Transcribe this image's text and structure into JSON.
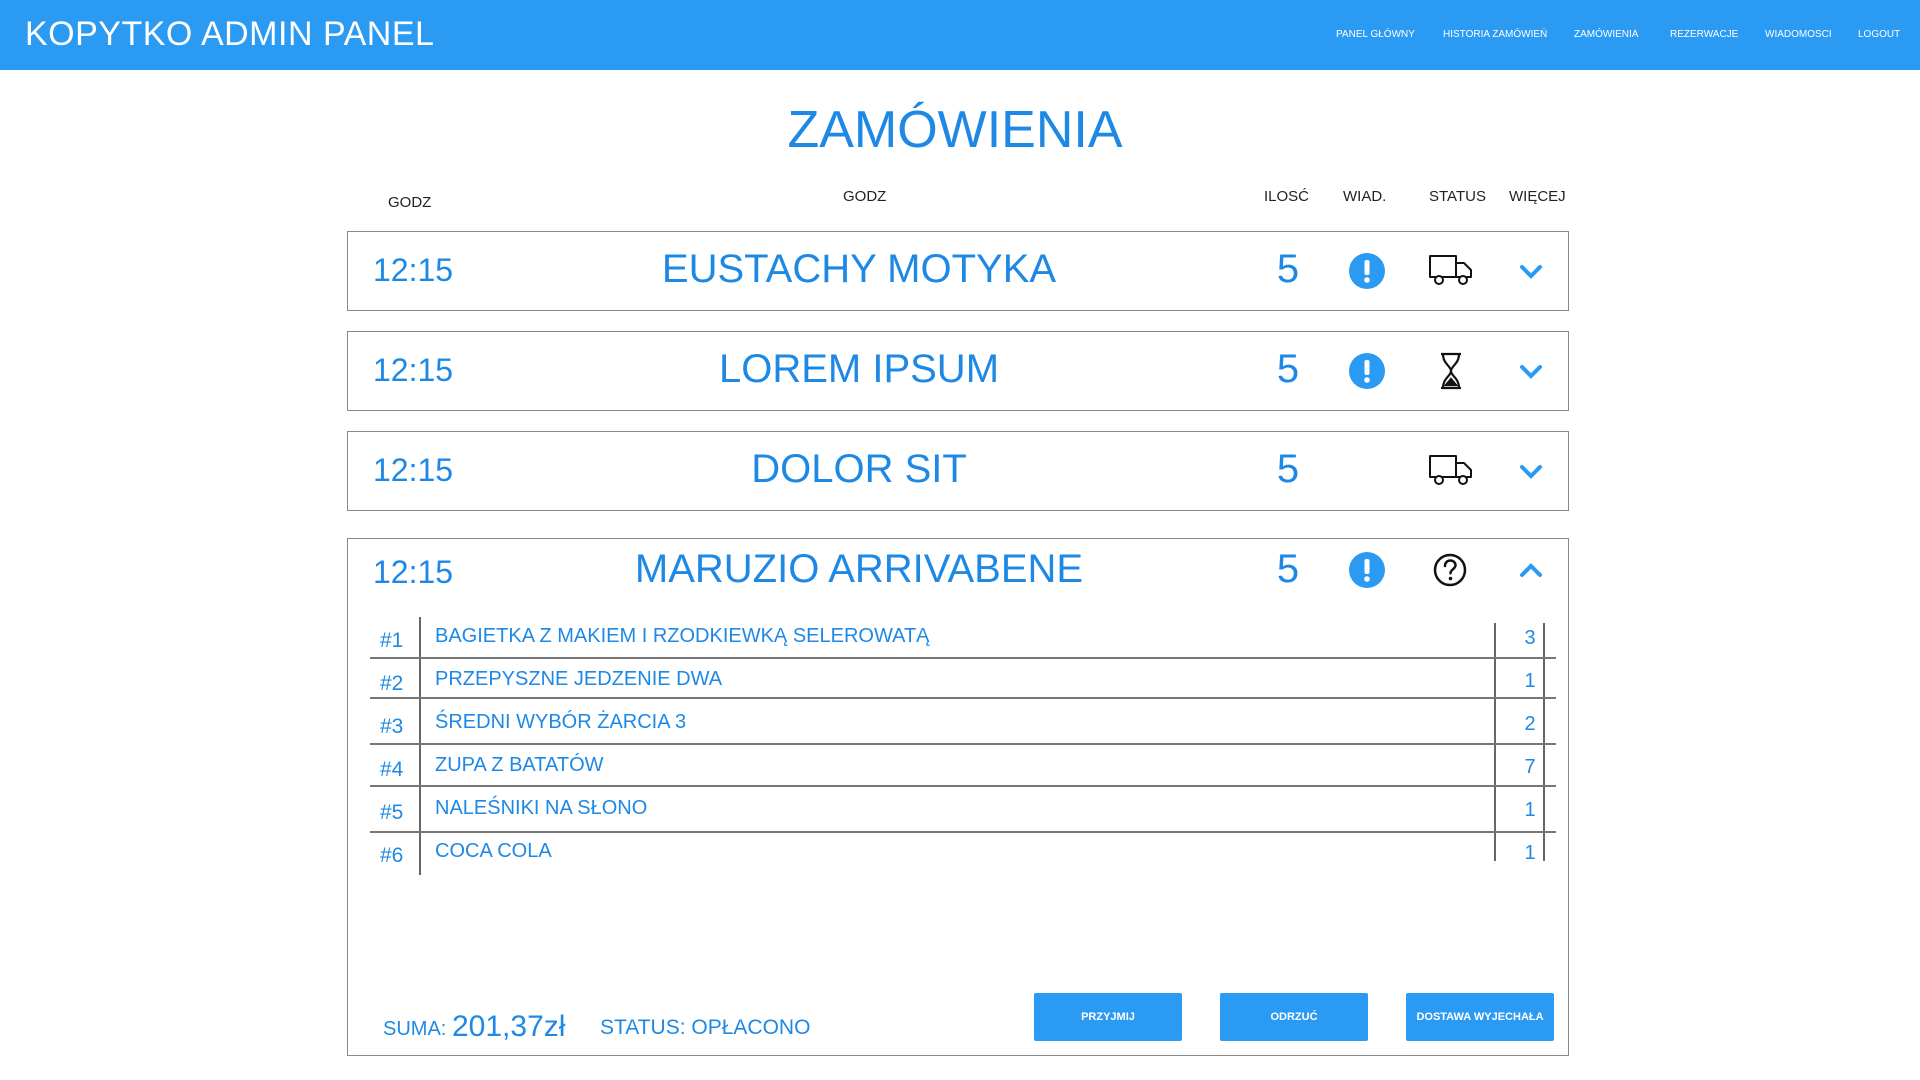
{
  "app": {
    "title": "KOPYTKO ADMIN PANEL"
  },
  "nav": [
    {
      "label": "PANEL GŁÓWNY"
    },
    {
      "label": "HISTORIA ZAMÓWIEŃ"
    },
    {
      "label": "ZAMÓWIENIA"
    },
    {
      "label": "REZERWACJE"
    },
    {
      "label": "WIADOMOSCI"
    },
    {
      "label": "LOGOUT"
    }
  ],
  "page": {
    "title": "ZAMÓWIENIA"
  },
  "columns": {
    "time": "GODZ",
    "name": "GODZ",
    "qty": "ILOSĆ",
    "msg": "WIAD.",
    "status": "STATUS",
    "more": "WIĘCEJ"
  },
  "colors": {
    "accent": "#2b9af3",
    "text": "#1e88e5",
    "border": "#8a8a8a"
  },
  "orders": [
    {
      "time": "12:15",
      "name": "EUSTACHY MOTYKA",
      "qty": "5",
      "has_message": true,
      "status_icon": "truck-icon",
      "expanded": false
    },
    {
      "time": "12:15",
      "name": "LOREM IPSUM",
      "qty": "5",
      "has_message": true,
      "status_icon": "hourglass-icon",
      "expanded": false
    },
    {
      "time": "12:15",
      "name": "DOLOR SIT",
      "qty": "5",
      "has_message": false,
      "status_icon": "truck-icon",
      "expanded": false
    },
    {
      "time": "12:15",
      "name": "MARUZIO ARRIVABENE",
      "qty": "5",
      "has_message": true,
      "status_icon": "question-icon",
      "expanded": true,
      "items": [
        {
          "num": "#1",
          "name": "BAGIETKA Z MAKIEM I RZODKIEWKĄ SELEROWATĄ",
          "qty": "3"
        },
        {
          "num": "#2",
          "name": "PRZEPYSZNE JEDZENIE DWA",
          "qty": "1"
        },
        {
          "num": "#3",
          "name": "ŚREDNI WYBÓR ŻARCIA 3",
          "qty": "2"
        },
        {
          "num": "#4",
          "name": "ZUPA Z BATATÓW",
          "qty": "7"
        },
        {
          "num": "#5",
          "name": "NALEŚNIKI NA SŁONO",
          "qty": "1"
        },
        {
          "num": "#6",
          "name": "COCA COLA",
          "qty": "1"
        }
      ],
      "sum_label": "SUMA:",
      "sum_value": "201,37zł",
      "status_text": "STATUS: OPŁACONO",
      "buttons": {
        "accept": "PRZYJMIJ",
        "reject": "ODRZUĆ",
        "dispatched": "DOSTAWA WYJECHAŁA"
      }
    }
  ]
}
